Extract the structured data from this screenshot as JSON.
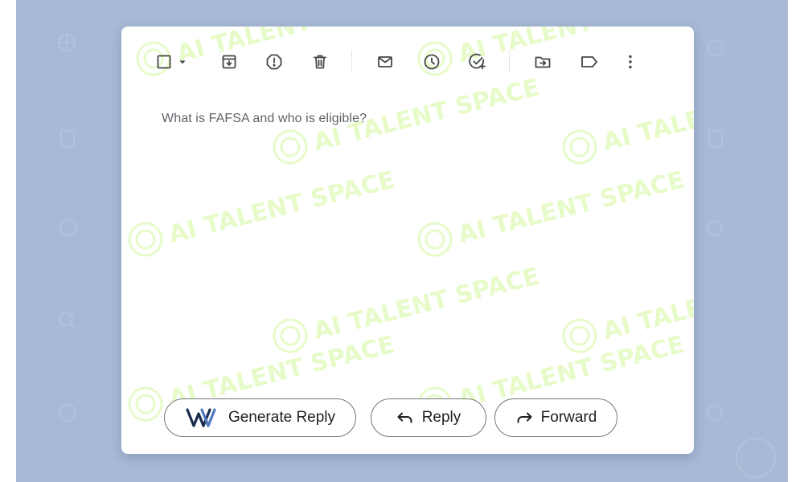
{
  "email": {
    "subject": "What is FAFSA and who is eligible?"
  },
  "toolbar": {
    "icons": [
      "checkbox-icon",
      "chevron-down-icon",
      "archive-icon",
      "report-spam-icon",
      "delete-icon",
      "mark-unread-icon",
      "snooze-icon",
      "add-task-icon",
      "move-to-icon",
      "label-icon",
      "more-options-icon"
    ]
  },
  "actions": {
    "generate_reply": "Generate Reply",
    "reply": "Reply",
    "forward": "Forward"
  },
  "watermark": {
    "text": "AI TALENT SPACE",
    "color": "#e7fbc9"
  },
  "colors": {
    "backdrop": "#a8b9d6",
    "card": "#ffffff",
    "icon": "#444746",
    "subject_text": "#5f6368"
  }
}
